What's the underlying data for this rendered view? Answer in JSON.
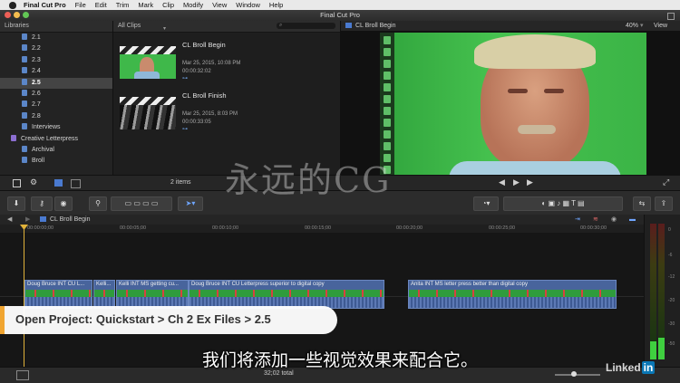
{
  "menubar": {
    "items": [
      "Final Cut Pro",
      "File",
      "Edit",
      "Trim",
      "Mark",
      "Clip",
      "Modify",
      "View",
      "Window",
      "Help"
    ]
  },
  "window": {
    "title": "Final Cut Pro"
  },
  "libraries": {
    "header": "Libraries",
    "items": [
      {
        "label": "2.1"
      },
      {
        "label": "2.2"
      },
      {
        "label": "2.3"
      },
      {
        "label": "2.4"
      },
      {
        "label": "2.5",
        "selected": true
      },
      {
        "label": "2.6"
      },
      {
        "label": "2.7"
      },
      {
        "label": "2.8"
      },
      {
        "label": "Interviews"
      },
      {
        "label": "Creative Letterpress"
      },
      {
        "label": "Archival"
      },
      {
        "label": "Broll"
      }
    ]
  },
  "clips": {
    "filter": "All Clips",
    "items": [
      {
        "title": "CL Broll Begin",
        "date": "Mar 25, 2015, 10:08 PM",
        "duration": "00:00:32:02"
      },
      {
        "title": "CL Broll Finish",
        "date": "Mar 25, 2015, 8:03 PM",
        "duration": "00:00:33:05"
      }
    ],
    "count": "2 items"
  },
  "viewer": {
    "clip_name": "CL Broll Begin",
    "zoom": "40%",
    "view_menu": "View"
  },
  "timeline": {
    "project_name": "CL Broll Begin",
    "ruler": [
      "00:00:00;00",
      "00:00:05;00",
      "00:00:10;00",
      "00:00:15;00",
      "00:00:20;00",
      "00:00:25;00",
      "00:00:30;00"
    ],
    "clips": [
      {
        "label": "Doug Bruce INT CU L..."
      },
      {
        "label": "Kelli..."
      },
      {
        "label": "Kelli INT MS getting cu..."
      },
      {
        "label": "Doug Bruce INT CU Letterpress superior to digital copy"
      },
      {
        "label": "Anita INT MS letter press better than digital copy"
      }
    ],
    "status": "32;02 total"
  },
  "meters": {
    "labels": [
      "0",
      "-6",
      "-12",
      "-20",
      "-30",
      "-50"
    ]
  },
  "overlay": {
    "lower_third": "Open Project: Quickstart > Ch 2 Ex Files > 2.5",
    "subtitle": "我们将添加一些视觉效果来配合它。",
    "watermark": "永远的CG",
    "brand": "Linked",
    "brand_in": "in"
  },
  "colors": {
    "accent": "#f0a531",
    "clip_blue": "#48649c",
    "green_screen": "#3fb84a"
  }
}
